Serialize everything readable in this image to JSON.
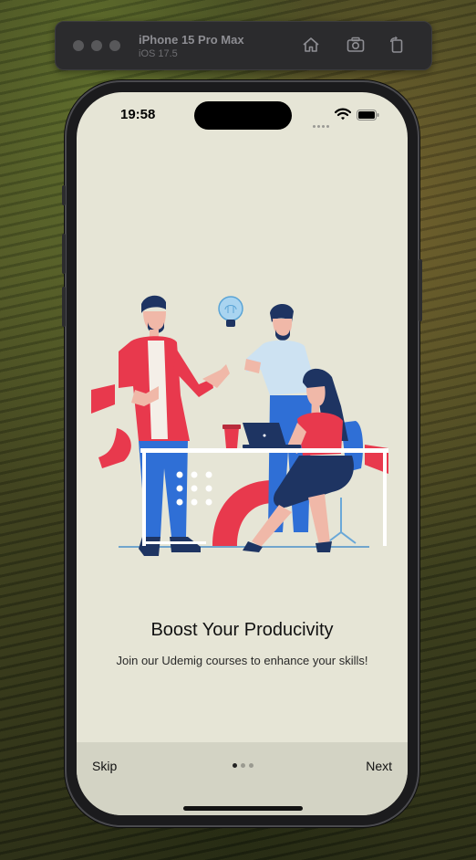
{
  "simulator": {
    "device_name": "iPhone 15 Pro Max",
    "os_version": "iOS 17.5",
    "toolbar_icons": [
      "home-icon",
      "screenshot-icon",
      "rotate-icon"
    ]
  },
  "status_bar": {
    "time": "19:58",
    "icons": [
      "signal-icon",
      "wifi-icon",
      "battery-icon"
    ]
  },
  "onboarding": {
    "title": "Boost Your Producivity",
    "subtitle": "Join our Udemig courses to enhance your skills!",
    "illustration": "team-working-illustration",
    "page_count": 3,
    "current_page": 1
  },
  "bottom_bar": {
    "skip_label": "Skip",
    "next_label": "Next"
  },
  "colors": {
    "screen_background": "#e6e5d6",
    "bottom_bar_background": "#d3d3c4",
    "accent_red": "#e8394d",
    "accent_blue": "#2f6fd6",
    "navy": "#1e3462",
    "dot_active": "#222222",
    "dot_inactive": "#9a9a90"
  }
}
